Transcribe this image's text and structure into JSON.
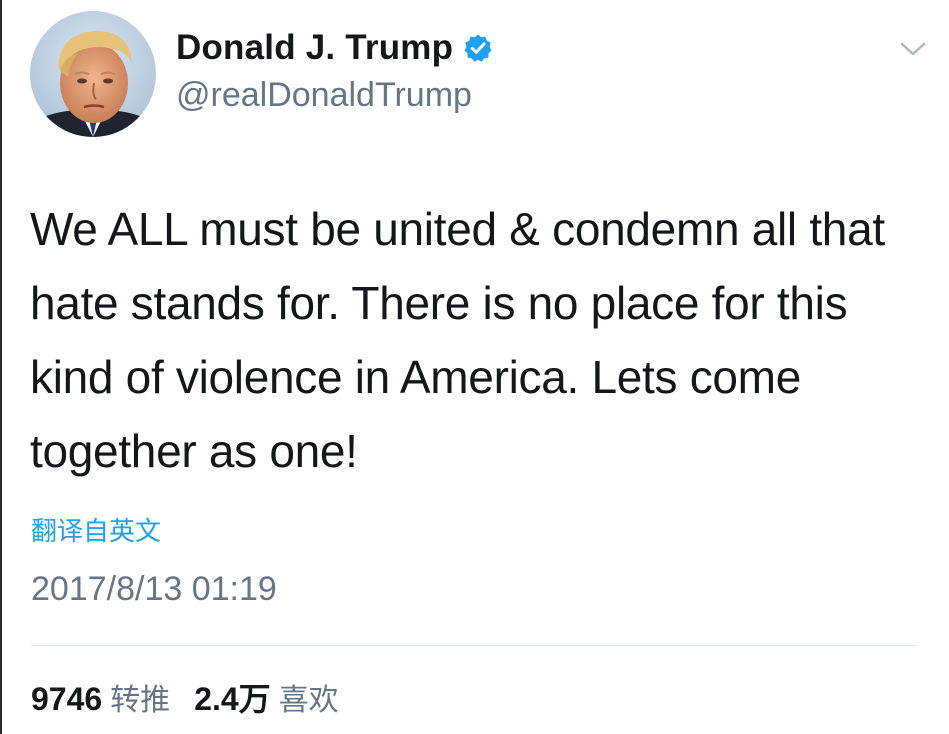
{
  "user": {
    "display_name": "Donald J. Trump",
    "handle": "@realDonaldTrump",
    "verified": true,
    "avatar_icon": "profile-photo"
  },
  "tweet": {
    "text": "We ALL must be united & condemn all that hate stands for. There is no place for this kind of violence in America. Lets come together as one!",
    "translate_label": "翻译自英文",
    "timestamp": "2017/8/13 01:19"
  },
  "stats": {
    "retweets_count": "9746",
    "retweets_label": "转推",
    "likes_count": "2.4万",
    "likes_label": "喜欢"
  },
  "icons": {
    "verified": "verified-badge-icon",
    "menu": "chevron-down-icon"
  },
  "colors": {
    "verified_blue": "#1da1f2",
    "link_blue": "#1da1f2",
    "secondary_text": "#657786",
    "primary_text": "#14171a",
    "divider": "#e1e8ed"
  }
}
